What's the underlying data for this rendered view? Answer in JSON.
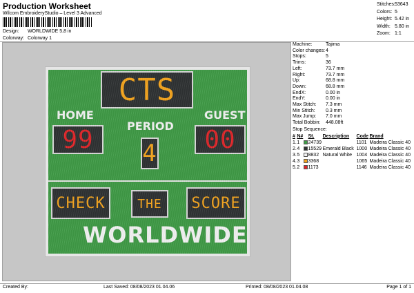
{
  "header": {
    "title": "Production Worksheet",
    "subtitle": "Wilcom EmbroideryStudio – Level 3 Advanced",
    "design_label": "Design:",
    "design_value": "WORLDWIDE 5,8 in",
    "colorway_label": "Colorway:",
    "colorway_value": "Colorway 1"
  },
  "stats": [
    {
      "label": "Stitches:",
      "value": "53643"
    },
    {
      "label": "Colors:",
      "value": "5"
    },
    {
      "label": "Height:",
      "value": "5.42 in"
    },
    {
      "label": "Width:",
      "value": "5.80 in"
    },
    {
      "label": "Zoom:",
      "value": "1:1"
    }
  ],
  "info": [
    {
      "label": "Machine:",
      "value": "Tajima"
    },
    {
      "label": "Color changes:",
      "value": "4"
    },
    {
      "label": "Stops:",
      "value": "5"
    },
    {
      "label": "Trims:",
      "value": "36"
    },
    {
      "label": "Left:",
      "value": "73.7 mm"
    },
    {
      "label": "Right:",
      "value": "73.7 mm"
    },
    {
      "label": "Up:",
      "value": "68.8 mm"
    },
    {
      "label": "Down:",
      "value": "68.8 mm"
    },
    {
      "label": "EndX:",
      "value": "0.00 in"
    },
    {
      "label": "EndY:",
      "value": "0.00 in"
    },
    {
      "label": "Max Stitch:",
      "value": "7.3 mm"
    },
    {
      "label": "Min Stitch:",
      "value": "0.3 mm"
    },
    {
      "label": "Max Jump:",
      "value": "7.0 mm"
    },
    {
      "label": "Total Bobbin:",
      "value": "448.08ft"
    }
  ],
  "stop_sequence": {
    "title": "Stop Sequence:",
    "headers": [
      "#",
      "N#",
      "",
      "St.",
      "Description",
      "Code",
      "Brand"
    ],
    "rows": [
      {
        "num": "1.",
        "n": "1",
        "color": "#3f9a46",
        "st": "24739",
        "desc": "",
        "code": "1101",
        "brand": "Madeira Classic 40"
      },
      {
        "num": "2.",
        "n": "4",
        "color": "#2f3233",
        "st": "15529",
        "desc": "Emerald Black",
        "code": "1000",
        "brand": "Madeira Classic 40"
      },
      {
        "num": "3.",
        "n": "5",
        "color": "#f2f2f2",
        "st": "8832",
        "desc": "Natural White",
        "code": "1004",
        "brand": "Madeira Classic 40"
      },
      {
        "num": "4.",
        "n": "3",
        "color": "#f4a41e",
        "st": "3368",
        "desc": "",
        "code": "1065",
        "brand": "Madeira Classic 40"
      },
      {
        "num": "5.",
        "n": "2",
        "color": "#e0262a",
        "st": "1173",
        "desc": "",
        "code": "1146",
        "brand": "Madeira Classic 40"
      }
    ]
  },
  "design": {
    "top_text": "CTS",
    "home_label": "HOME",
    "guest_label": "GUEST",
    "period_label": "PERIOD",
    "home_score": "99",
    "guest_score": "00",
    "period_value": "4",
    "check": "CHECK",
    "the": "THE",
    "score": "SCORE",
    "bottom_text": "WORLDWIDE"
  },
  "footer": {
    "created": "Created By:",
    "saved": "Last Saved: 08/08/2023 01.04.06",
    "printed": "Printed: 08/08/2023 01.04.08",
    "page": "Page 1 of 1"
  }
}
